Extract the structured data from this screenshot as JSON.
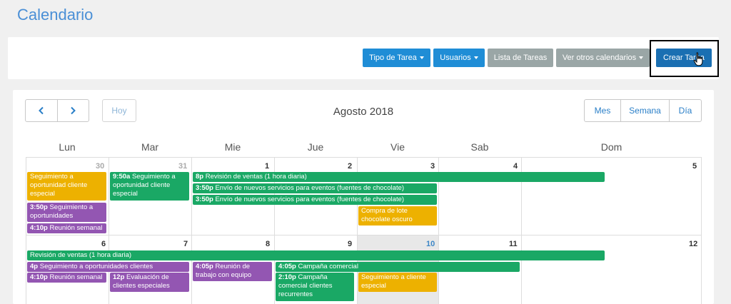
{
  "page": {
    "title": "Calendario"
  },
  "toolbar": {
    "tipo_tarea": "Tipo de Tarea",
    "usuarios": "Usuarios",
    "lista_tareas": "Lista de Tareas",
    "ver_otros": "Ver otros calendarios",
    "crear_tarea": "Crear Tarea"
  },
  "calendar": {
    "today_label": "Hoy",
    "month_title": "Agosto 2018",
    "views": {
      "month": "Mes",
      "week": "Semana",
      "day": "Día"
    },
    "weekdays": [
      "Lun",
      "Mar",
      "Mie",
      "Jue",
      "Vie",
      "Sab",
      "Dom"
    ],
    "week1_days": [
      "30",
      "31",
      "1",
      "2",
      "3",
      "4",
      "5"
    ],
    "week2_days": [
      "6",
      "7",
      "8",
      "9",
      "10",
      "11",
      "12"
    ],
    "today": "10"
  },
  "colors": {
    "green": "#1aa865",
    "purple": "#9356b2",
    "yellow": "#edb100",
    "primary": "#1f8dd6"
  },
  "events": {
    "w1_seg_oport": {
      "time": "",
      "title": "Seguimiento a oportunidad cliente especial"
    },
    "w1_mar_seg": {
      "time": "9:50a",
      "title": "Seguimiento a oportunidad cliente especial"
    },
    "w1_revision": {
      "time": "8p",
      "title": "Revisión de ventas (1 hora diaria)"
    },
    "w1_envio1": {
      "time": "3:50p",
      "title": "Envío de nuevos servicios para eventos (fuentes de chocolate)"
    },
    "w1_envio2": {
      "time": "3:50p",
      "title": "Envío de nuevos servicios para eventos (fuentes de chocolate)"
    },
    "w1_seg_oports": {
      "time": "3:50p",
      "title": "Seguimiento a oportunidades"
    },
    "w1_compra": {
      "time": "",
      "title": "Compra de lote chocolate oscuro"
    },
    "w1_reunion": {
      "time": "4:10p",
      "title": "Reunión semanal"
    },
    "w2_revision": {
      "time": "",
      "title": "Revisión de ventas (1 hora diaria)"
    },
    "w2_seg_oports": {
      "time": "4p",
      "title": "Seguimiento a oportunidades clientes especiales"
    },
    "w2_reunion_trab": {
      "time": "4:05p",
      "title": "Reunión de trabajo con equipo"
    },
    "w2_campana1": {
      "time": "4:05p",
      "title": "Campaña comercial"
    },
    "w2_reunion": {
      "time": "4:10p",
      "title": "Reunión semanal"
    },
    "w2_evaluacion": {
      "time": "12p",
      "title": "Evaluación de clientes especiales"
    },
    "w2_campana2": {
      "time": "2:10p",
      "title": "Campaña comercial clientes recurrentes"
    },
    "w2_seg_cliente": {
      "time": "",
      "title": "Seguimiento a cliente especial"
    }
  }
}
